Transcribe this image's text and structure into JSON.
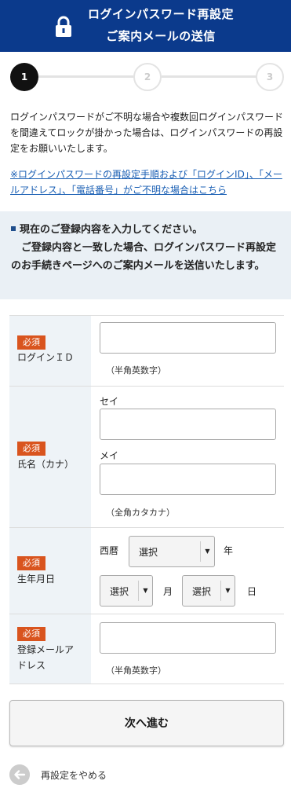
{
  "header": {
    "title_line1": "ログインパスワード再設定",
    "title_line2": "ご案内メールの送信",
    "icon": "lock-icon",
    "bg_color": "#0b3a8c"
  },
  "steps": {
    "items": [
      "1",
      "2",
      "3"
    ],
    "current": 1
  },
  "intro": {
    "text": "ログインパスワードがご不明な場合や複数回ログインパスワードを間違えてロックが掛かった場合は、ログインパスワードの再設定をお願いいたします。",
    "help_link": "※ログインパスワードの再設定手順および「ログインID」、「メールアドレス」、「電話番号」がご不明な場合はこちら"
  },
  "notice": {
    "line1": "現在のご登録内容を入力してください。",
    "line2": "ご登録内容と一致した場合、ログインパスワード再設定のお手続きページへのご案内メールを送信いたします。"
  },
  "form": {
    "required_label": "必須",
    "login_id": {
      "label": "ログインＩＤ",
      "value": "",
      "note": "（半角英数字）"
    },
    "name": {
      "label": "氏名（カナ）",
      "sei_label": "セイ",
      "sei_value": "",
      "mei_label": "メイ",
      "mei_value": "",
      "note": "（全角カタカナ）"
    },
    "birthday": {
      "label": "生年月日",
      "era_label": "西暦",
      "year_value": "選択",
      "year_unit": "年",
      "month_value": "選択",
      "month_unit": "月",
      "day_value": "選択",
      "day_unit": "日"
    },
    "email": {
      "label_line1": "登録メールア",
      "label_line2": "ドレス",
      "value": "",
      "note": "（半角英数字）"
    }
  },
  "actions": {
    "next_label": "次へ進む",
    "cancel_label": "再設定をやめる"
  },
  "colors": {
    "required_badge": "#d9541e",
    "link": "#1a5fb4",
    "notice_bg": "#eaf0f5"
  }
}
